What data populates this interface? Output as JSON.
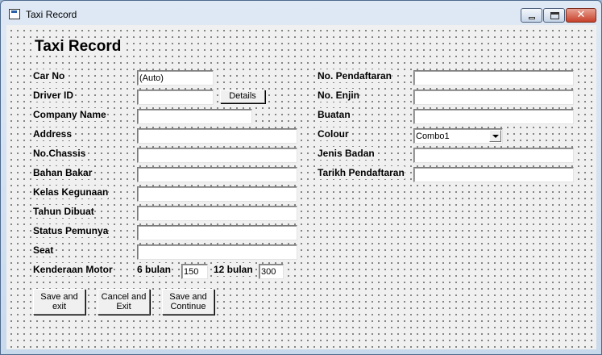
{
  "window": {
    "title": "Taxi Record"
  },
  "form": {
    "heading": "Taxi Record",
    "left_fields": [
      {
        "label": "Car No",
        "value": "(Auto)"
      },
      {
        "label": "Driver ID",
        "value": "",
        "button": "Details"
      },
      {
        "label": "Company Name",
        "value": ""
      },
      {
        "label": "Address",
        "value": ""
      },
      {
        "label": "No.Chassis",
        "value": ""
      },
      {
        "label": "Bahan Bakar",
        "value": ""
      },
      {
        "label": "Kelas Kegunaan",
        "value": ""
      },
      {
        "label": "Tahun Dibuat",
        "value": ""
      },
      {
        "label": "Status Pemunya",
        "value": ""
      },
      {
        "label": "Seat",
        "value": ""
      }
    ],
    "kenderaan": {
      "label": "Kenderaan Motor",
      "six_label": "6 bulan",
      "six_value": "150",
      "twelve_label": "12 bulan",
      "twelve_value": "300"
    },
    "right_fields": [
      {
        "label": "No. Pendaftaran",
        "value": ""
      },
      {
        "label": "No. Enjin",
        "value": ""
      },
      {
        "label": "Buatan",
        "value": ""
      },
      {
        "label": "Colour",
        "combo": "Combo1"
      },
      {
        "label": "Jenis Badan",
        "value": ""
      },
      {
        "label": "Tarikh Pendaftaran",
        "value": ""
      }
    ]
  },
  "buttons": {
    "save_exit": [
      "Save and",
      "exit"
    ],
    "cancel_exit": [
      "Cancel and",
      "Exit"
    ],
    "save_continue": [
      "Save and",
      "Continue"
    ]
  }
}
